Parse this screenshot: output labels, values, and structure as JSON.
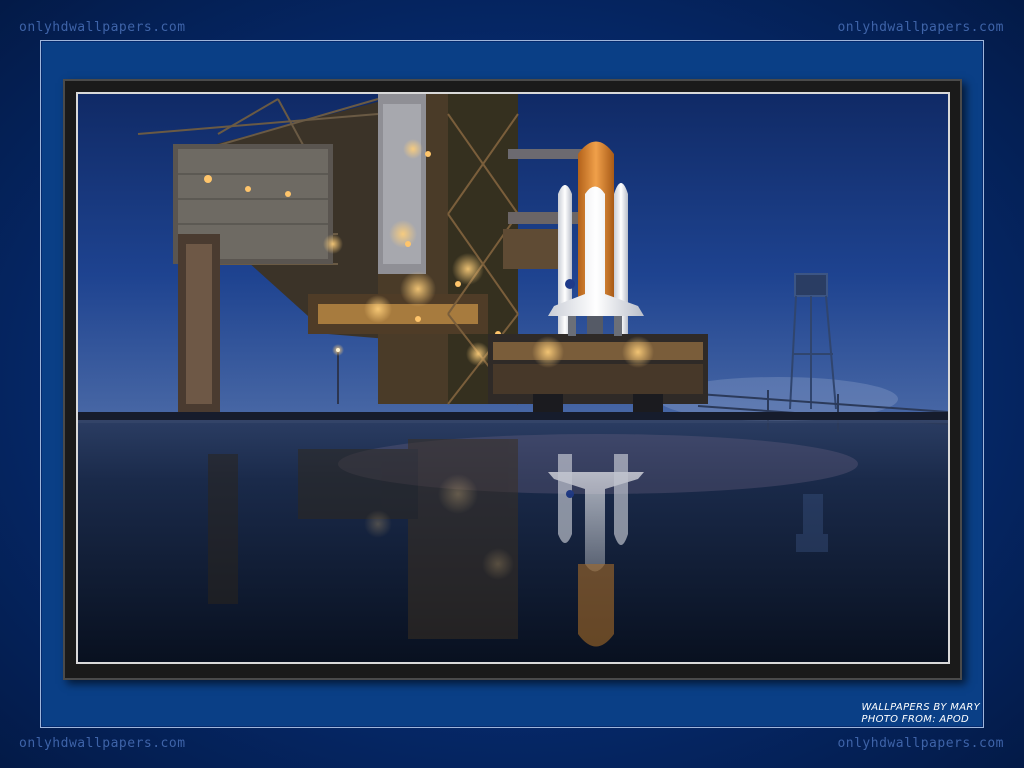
{
  "watermarks": {
    "top_left": "onlyhdwallpapers.com",
    "top_right": "onlyhdwallpapers.com",
    "bottom_left": "onlyhdwallpapers.com",
    "bottom_right": "onlyhdwallpapers.com"
  },
  "credits": {
    "line1": "WALLPAPERS BY MARY",
    "line2": "PHOTO FROM: APOD"
  },
  "colors": {
    "background": "#062a6d",
    "mat": "#0a3f86",
    "sky_top": "#1b3f8a",
    "sky_horizon": "#3e5f9e",
    "tower_light": "#f2a540",
    "external_tank": "#e08a1e"
  }
}
